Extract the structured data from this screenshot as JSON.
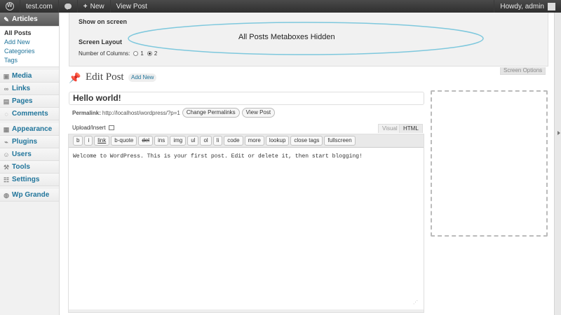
{
  "adminbar": {
    "site_name": "test.com",
    "new_label": "New",
    "view_post": "View Post",
    "howdy": "Howdy, admin"
  },
  "sidebar": {
    "active_menu": "Articles",
    "submenu": [
      "All Posts",
      "Add New",
      "Categories",
      "Tags"
    ],
    "items": [
      {
        "label": "Media",
        "icon": "media-icon"
      },
      {
        "label": "Links",
        "icon": "links-icon"
      },
      {
        "label": "Pages",
        "icon": "pages-icon"
      },
      {
        "label": "Comments",
        "icon": "comments-icon"
      },
      {
        "label": "Appearance",
        "icon": "appearance-icon"
      },
      {
        "label": "Plugins",
        "icon": "plugins-icon"
      },
      {
        "label": "Users",
        "icon": "users-icon"
      },
      {
        "label": "Tools",
        "icon": "tools-icon"
      },
      {
        "label": "Settings",
        "icon": "settings-icon"
      },
      {
        "label": "Wp Grande",
        "icon": "wp-grande-icon"
      }
    ]
  },
  "screen_options": {
    "show_on_screen": "Show on screen",
    "screen_layout": "Screen Layout",
    "columns_label": "Number of Columns:",
    "col_1": "1",
    "col_2": "2",
    "selected_columns": "2",
    "annotation": "All Posts Metaboxes Hidden",
    "toggle_label": "Screen Options",
    "ellipse_color": "#7ec8dd"
  },
  "page": {
    "title": "Edit Post",
    "add_new": "Add New"
  },
  "post": {
    "title": "Hello world!",
    "permalink_label": "Permalink:",
    "permalink_url": "http://localhost/wordpress/?p=1",
    "change_permalinks": "Change Permalinks",
    "view_post": "View Post",
    "upload_insert": "Upload/Insert",
    "tab_visual": "Visual",
    "tab_html": "HTML",
    "active_tab": "HTML",
    "content": "Welcome to WordPress. This is your first post. Edit or delete it, then start blogging!"
  },
  "quicktags": [
    "b",
    "i",
    "link",
    "b-quote",
    "del",
    "ins",
    "img",
    "ul",
    "ol",
    "li",
    "code",
    "more",
    "lookup",
    "close tags",
    "fullscreen"
  ],
  "colors": {
    "link": "#21759b",
    "adminbar": "#464646",
    "active_menu": "#6d6d6d"
  }
}
